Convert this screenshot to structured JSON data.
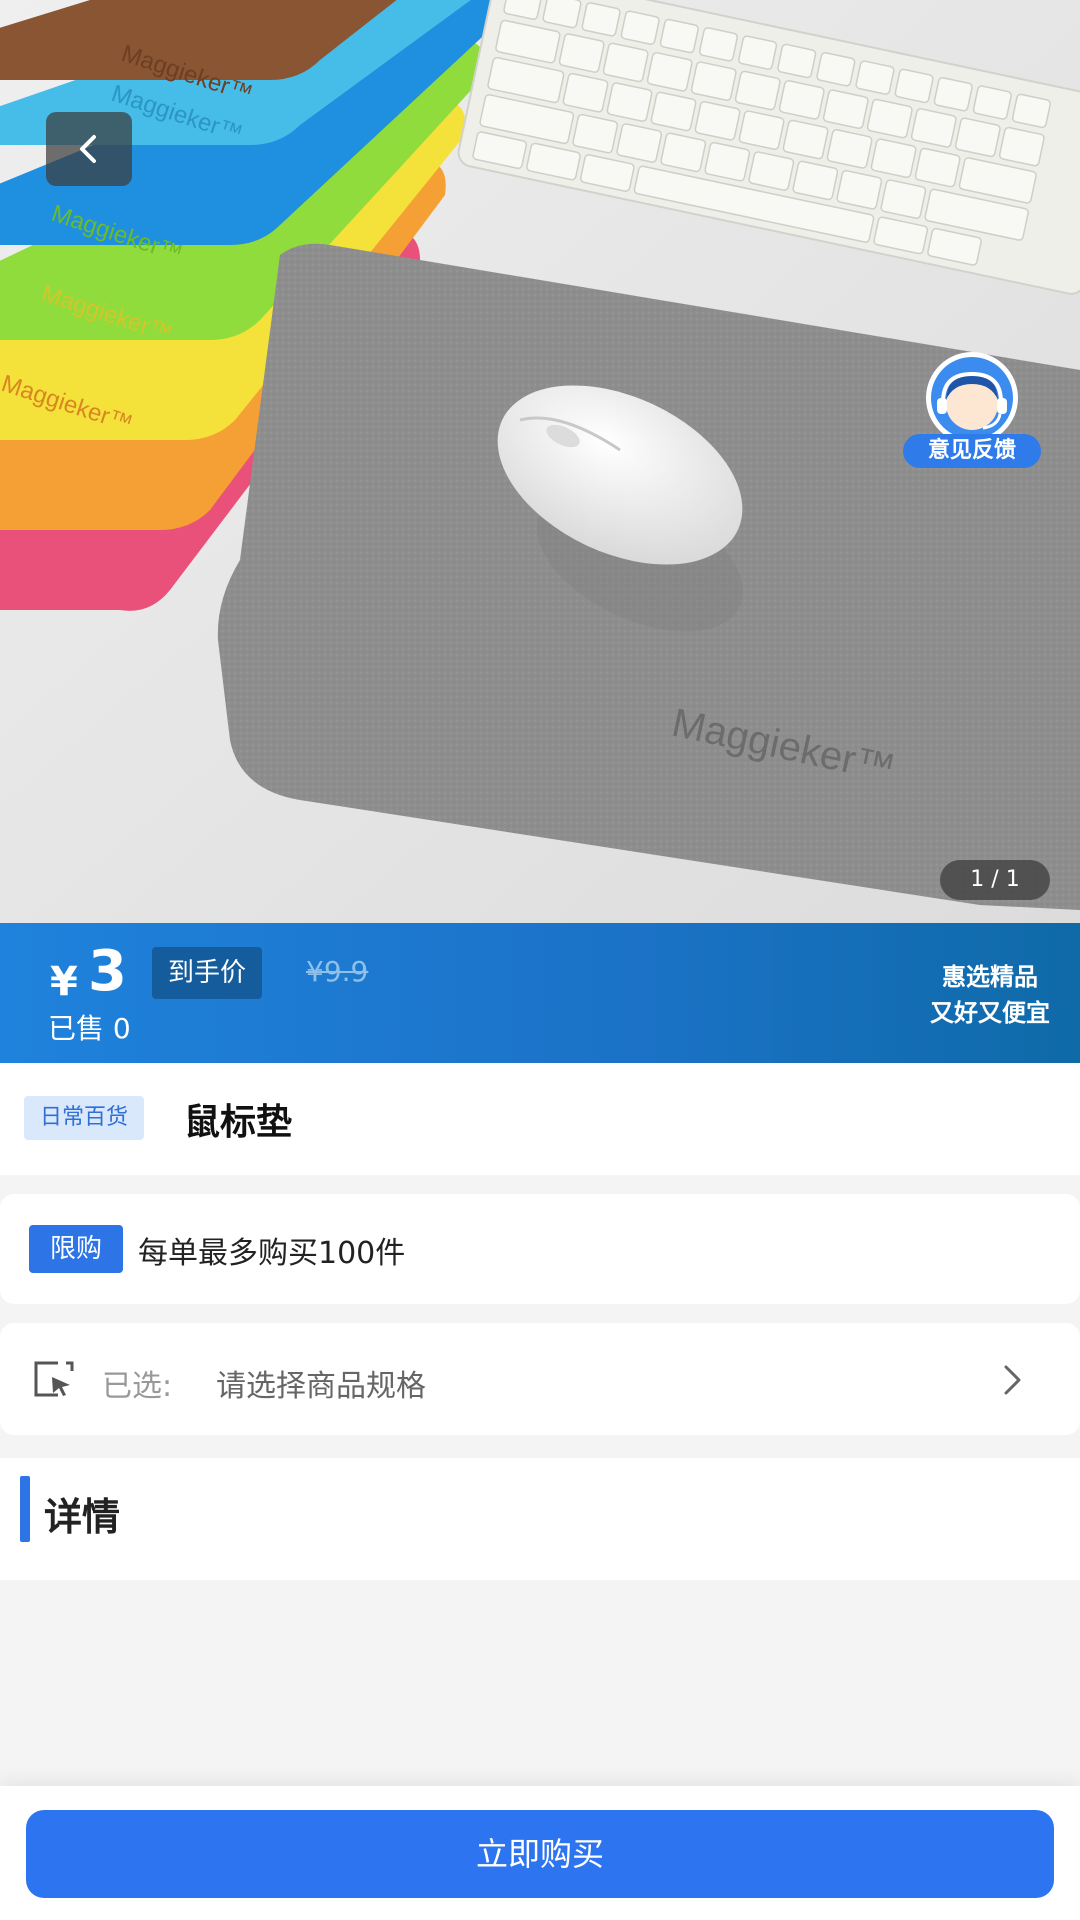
{
  "hero": {
    "brand_text": "Maggieker™",
    "feedback_label": "意见反馈",
    "image_counter": "1 / 1"
  },
  "price_bar": {
    "currency": "¥",
    "price": "3",
    "price_tag": "到手价",
    "original_price": "¥9.9",
    "sold": "已售 0",
    "slogan_line1": "惠选精品",
    "slogan_line2": "又好又便宜"
  },
  "product": {
    "category": "日常百货",
    "name": "鼠标垫"
  },
  "limit": {
    "badge": "限购",
    "text": "每单最多购买100件"
  },
  "spec": {
    "label": "已选:",
    "value": "请选择商品规格"
  },
  "details": {
    "heading": "详情"
  },
  "bottom": {
    "buy_label": "立即购买"
  },
  "colors": {
    "accent": "#2d74f0",
    "price_bar_start": "#1f82dc",
    "price_bar_end": "#0f6aa8"
  }
}
